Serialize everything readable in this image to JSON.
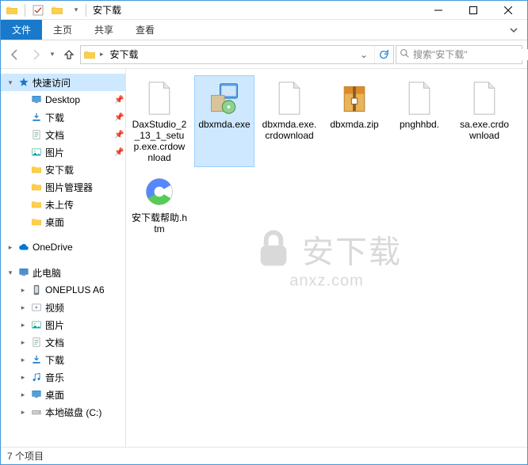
{
  "title": "安下载",
  "ribbon": {
    "file": "文件",
    "home": "主页",
    "share": "共享",
    "view": "查看"
  },
  "address": {
    "crumb": "安下载"
  },
  "search": {
    "placeholder": "搜索\"安下载\""
  },
  "tree": {
    "quick": "快速访问",
    "quick_items": [
      {
        "label": "Desktop",
        "icon": "desktop",
        "pinned": true
      },
      {
        "label": "下载",
        "icon": "download",
        "pinned": true
      },
      {
        "label": "文档",
        "icon": "doc",
        "pinned": true
      },
      {
        "label": "图片",
        "icon": "pic",
        "pinned": true
      },
      {
        "label": "安下载",
        "icon": "folder"
      },
      {
        "label": "图片管理器",
        "icon": "folder"
      },
      {
        "label": "未上传",
        "icon": "folder"
      },
      {
        "label": "桌面",
        "icon": "folder"
      }
    ],
    "onedrive": "OneDrive",
    "thispc": "此电脑",
    "pc_items": [
      {
        "label": "ONEPLUS A6",
        "icon": "phone"
      },
      {
        "label": "视频",
        "icon": "video"
      },
      {
        "label": "图片",
        "icon": "pic"
      },
      {
        "label": "文档",
        "icon": "doc"
      },
      {
        "label": "下载",
        "icon": "download"
      },
      {
        "label": "音乐",
        "icon": "music"
      },
      {
        "label": "桌面",
        "icon": "desktop"
      },
      {
        "label": "本地磁盘 (C:)",
        "icon": "drive"
      }
    ]
  },
  "files": [
    {
      "label": "DaxStudio_2_13_1_setup.exe.crdownload",
      "type": "blank"
    },
    {
      "label": "dbxmda.exe",
      "type": "exe",
      "selected": true
    },
    {
      "label": "dbxmda.exe.crdownload",
      "type": "blank"
    },
    {
      "label": "dbxmda.zip",
      "type": "zip"
    },
    {
      "label": "pnghhbd.",
      "type": "blank"
    },
    {
      "label": "sa.exe.crdownload",
      "type": "blank"
    },
    {
      "label": "安下载帮助.htm",
      "type": "htm"
    }
  ],
  "watermark": {
    "line1": "安下载",
    "line2": "anxz.com"
  },
  "status": "7 个项目"
}
